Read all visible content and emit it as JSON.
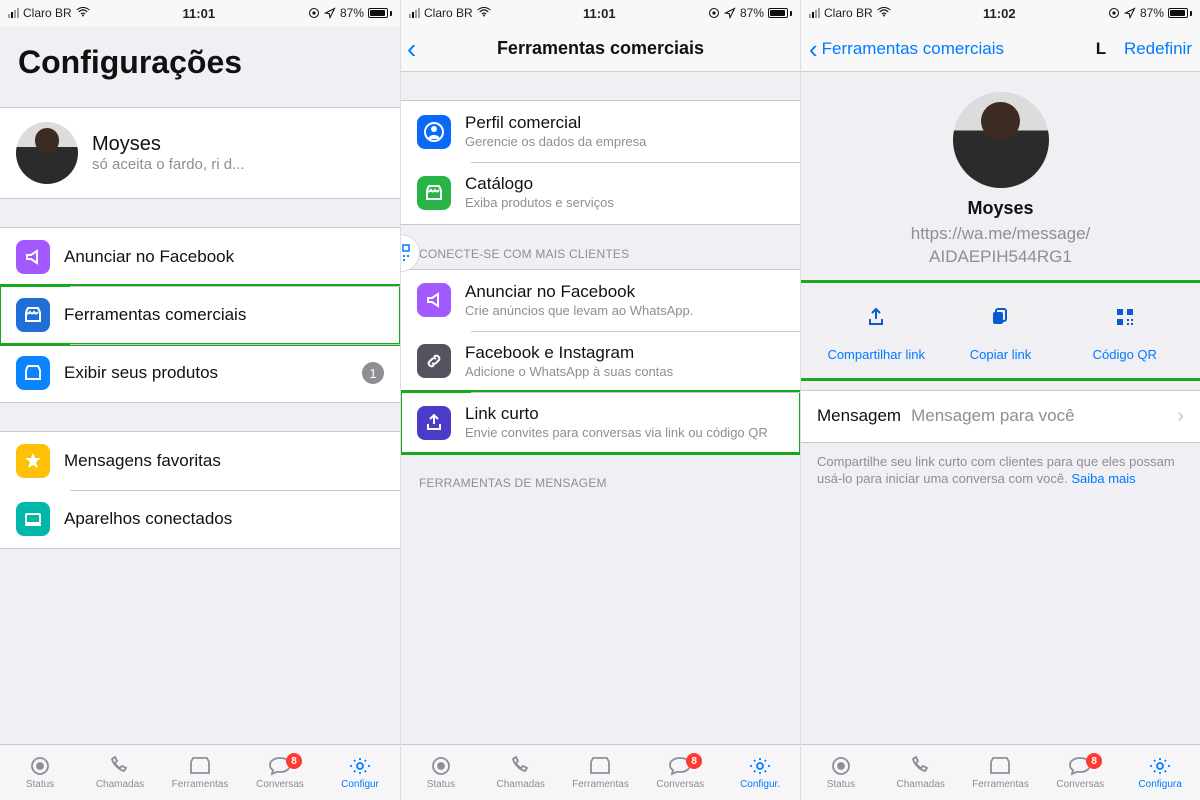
{
  "statusbar": {
    "carrier": "Claro BR",
    "time1": "11:01",
    "time2": "11:01",
    "time3": "11:02",
    "battery_pct": "87%"
  },
  "panel1": {
    "title": "Configurações",
    "profile": {
      "name": "Moyses",
      "status": "só aceita o fardo, ri d..."
    },
    "rows": [
      {
        "label": "Anunciar no Facebook"
      },
      {
        "label": "Ferramentas comerciais"
      },
      {
        "label": "Exibir seus produtos",
        "badge": "1"
      }
    ],
    "rows2": [
      {
        "label": "Mensagens favoritas"
      },
      {
        "label": "Aparelhos conectados"
      }
    ]
  },
  "panel2": {
    "title": "Ferramentas comerciais",
    "group1": [
      {
        "title": "Perfil comercial",
        "sub": "Gerencie os dados da empresa"
      },
      {
        "title": "Catálogo",
        "sub": "Exiba produtos e serviços"
      }
    ],
    "sect_label1": "CONECTE-SE COM MAIS CLIENTES",
    "group2": [
      {
        "title": "Anunciar no Facebook",
        "sub": "Crie anúncios que levam ao WhatsApp."
      },
      {
        "title": "Facebook e Instagram",
        "sub": "Adicione o WhatsApp à suas contas"
      },
      {
        "title": "Link curto",
        "sub": "Envie convites para conversas via link ou código QR"
      }
    ],
    "sect_label2": "FERRAMENTAS DE MENSAGEM"
  },
  "panel3": {
    "back": "Ferramentas comerciais",
    "navtitle": "L",
    "right": "Redefinir",
    "name": "Moyses",
    "url_l1": "https://wa.me/message/",
    "url_l2": "AIDAEPIH544RG1",
    "actions": {
      "share": "Compartilhar link",
      "copy": "Copiar link",
      "qr": "Código QR"
    },
    "msg_label": "Mensagem",
    "msg_placeholder": "Mensagem para você",
    "footer": "Compartilhe seu link curto com clientes para que eles possam usá-lo para iniciar uma conversa com você. ",
    "footer_link": "Saiba mais"
  },
  "tabs": {
    "status": "Status",
    "chamadas": "Chamadas",
    "ferramentas": "Ferramentas",
    "conversas": "Conversas",
    "config": "Configur",
    "config2": "Configur.",
    "config3": "Configura",
    "badge": "8"
  },
  "colors": {
    "blue": "#007aff",
    "purple": "#a259ff",
    "darkblue": "#3253b5",
    "green": "#28b446",
    "teal": "#009688",
    "yellow": "#ffc107",
    "gray": "#6c6c70",
    "indigo": "#4a3cc6"
  }
}
